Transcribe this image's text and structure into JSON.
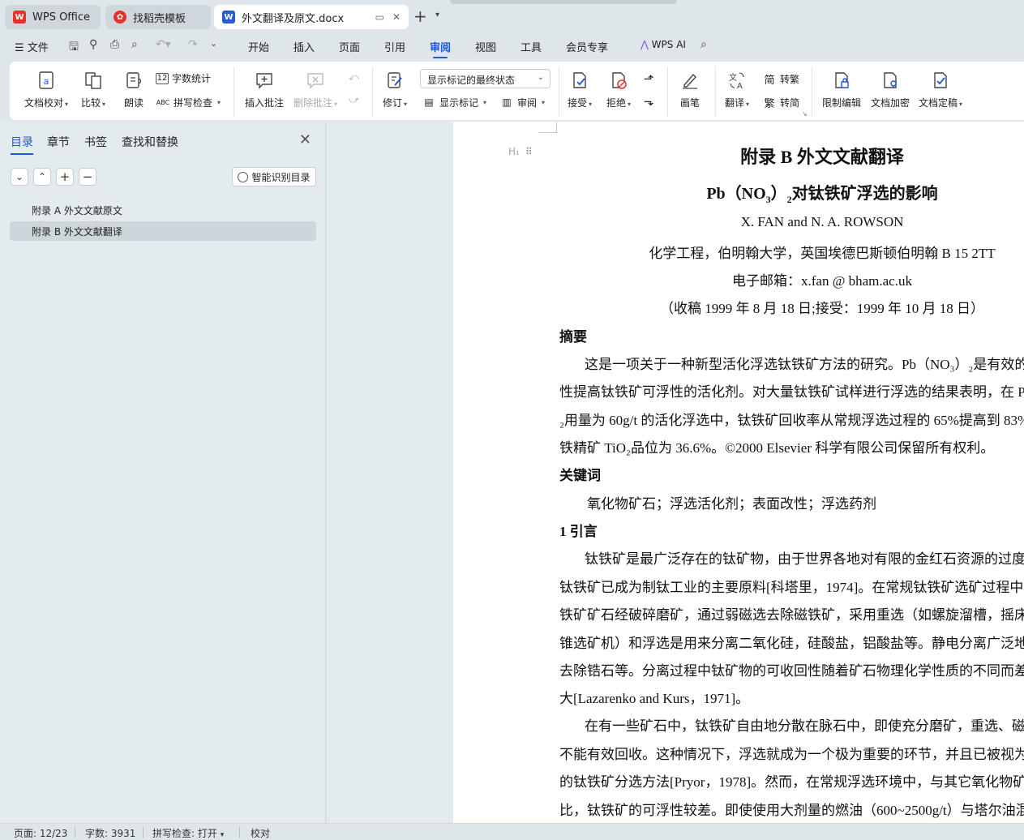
{
  "tabs": [
    {
      "label": "WPS Office",
      "icon": "wps-logo"
    },
    {
      "label": "找稻壳模板",
      "icon": "docer-logo"
    },
    {
      "label": "外文翻译及原文.docx",
      "icon": "writer-logo"
    }
  ],
  "menu": {
    "file": "文件",
    "items": [
      "开始",
      "插入",
      "页面",
      "引用",
      "审阅",
      "视图",
      "工具",
      "会员专享"
    ],
    "active": "审阅",
    "ai": "WPS AI"
  },
  "ribbon": {
    "proofread": "文档校对",
    "compare": "比较",
    "read_aloud": "朗读",
    "word_count": "字数统计",
    "spell_check": "拼写检查",
    "insert_comment": "插入批注",
    "delete_comment": "删除批注",
    "track": "修订",
    "markup_state": "显示标记的最终状态",
    "show_markup": "显示标记",
    "review": "审阅",
    "accept": "接受",
    "reject": "拒绝",
    "pen": "画笔",
    "translate": "翻译",
    "to_traditional": "转繁",
    "to_simplified": "转简",
    "restrict": "限制编辑",
    "encrypt": "文档加密",
    "finalize": "文档定稿"
  },
  "nav": {
    "tabs": [
      "目录",
      "章节",
      "书签",
      "查找和替换"
    ],
    "smart_button": "智能识别目录",
    "toc": [
      "附录 A  外文文献原文",
      "附录 B  外文文献翻译"
    ],
    "selected": 1
  },
  "doc": {
    "title": "附录 B  外文文献翻译",
    "subtitle_pre": "Pb（NO",
    "subtitle_sub1": "3",
    "subtitle_mid": "）",
    "subtitle_sub2": "2",
    "subtitle_post": "对钛铁矿浮选的影响",
    "authors": "X. FAN and N. A. ROWSON",
    "affiliation": "化学工程，伯明翰大学，英国埃德巴斯顿伯明翰 B 15 2TT",
    "email": "电子邮箱：x.fan @ bham.ac.uk",
    "received": "（收稿 1999 年 8 月 18 日;接受：1999 年 10 月 18 日）",
    "abstract_heading": "摘要",
    "abstract_lines": [
      "这是一项关于一种新型活化浮选钛铁矿方法的研究。Pb（NO₃）₂是有效的",
      "性提高钛铁矿可浮性的活化剂。对大量钛铁矿试样进行浮选的结果表明，在 Pb(",
      "₂用量为 60g/t 的活化浮选中，钛铁矿回收率从常规浮选过程的 65%提高到 83%",
      "铁精矿 TiO₂品位为 36.6%。©2000 Elsevier 科学有限公司保留所有权利。"
    ],
    "keywords_heading": "关键词",
    "keywords": "氧化物矿石；浮选活化剂；表面改性；浮选药剂",
    "intro_heading": "1 引言",
    "intro_lines": [
      "钛铁矿是最广泛存在的钛矿物，由于世界各地对有限的金红石资源的过度",
      "钛铁矿已成为制钛工业的主要原料[科塔里，1974]。在常规钛铁矿选矿过程中",
      "铁矿矿石经破碎磨矿，通过弱磁选去除磁铁矿，采用重选（如螺旋溜槽，摇床",
      "锥选矿机）和浮选是用来分离二氧化硅，硅酸盐，铝酸盐等。静电分离广泛地",
      "去除锆石等。分离过程中钛矿物的可收回性随着矿石物理化学性质的不同而差",
      "大[Lazarenko and Kurs，1971]。",
      "在有一些矿石中，钛铁矿自由地分散在脉石中，即使充分磨矿，重选、磁",
      "不能有效回收。这种情况下，浮选就成为一个极为重要的环节，并且已被视为",
      "的钛铁矿分选方法[Pryor，1978]。然而，在常规浮选环境中，与其它氧化物矿",
      "比，钛铁矿的可浮性较差。即使使用大剂量的燃油（600~2500g/t）与塔尔油混"
    ]
  },
  "status": {
    "page": "页面: 12/23",
    "words": "字数: 3931",
    "spell": "拼写检查: 打开",
    "proof": "校对"
  },
  "colors": {
    "accent": "#1f58d6",
    "wps_red": "#e5322d",
    "writer_blue": "#2a5bd7"
  }
}
